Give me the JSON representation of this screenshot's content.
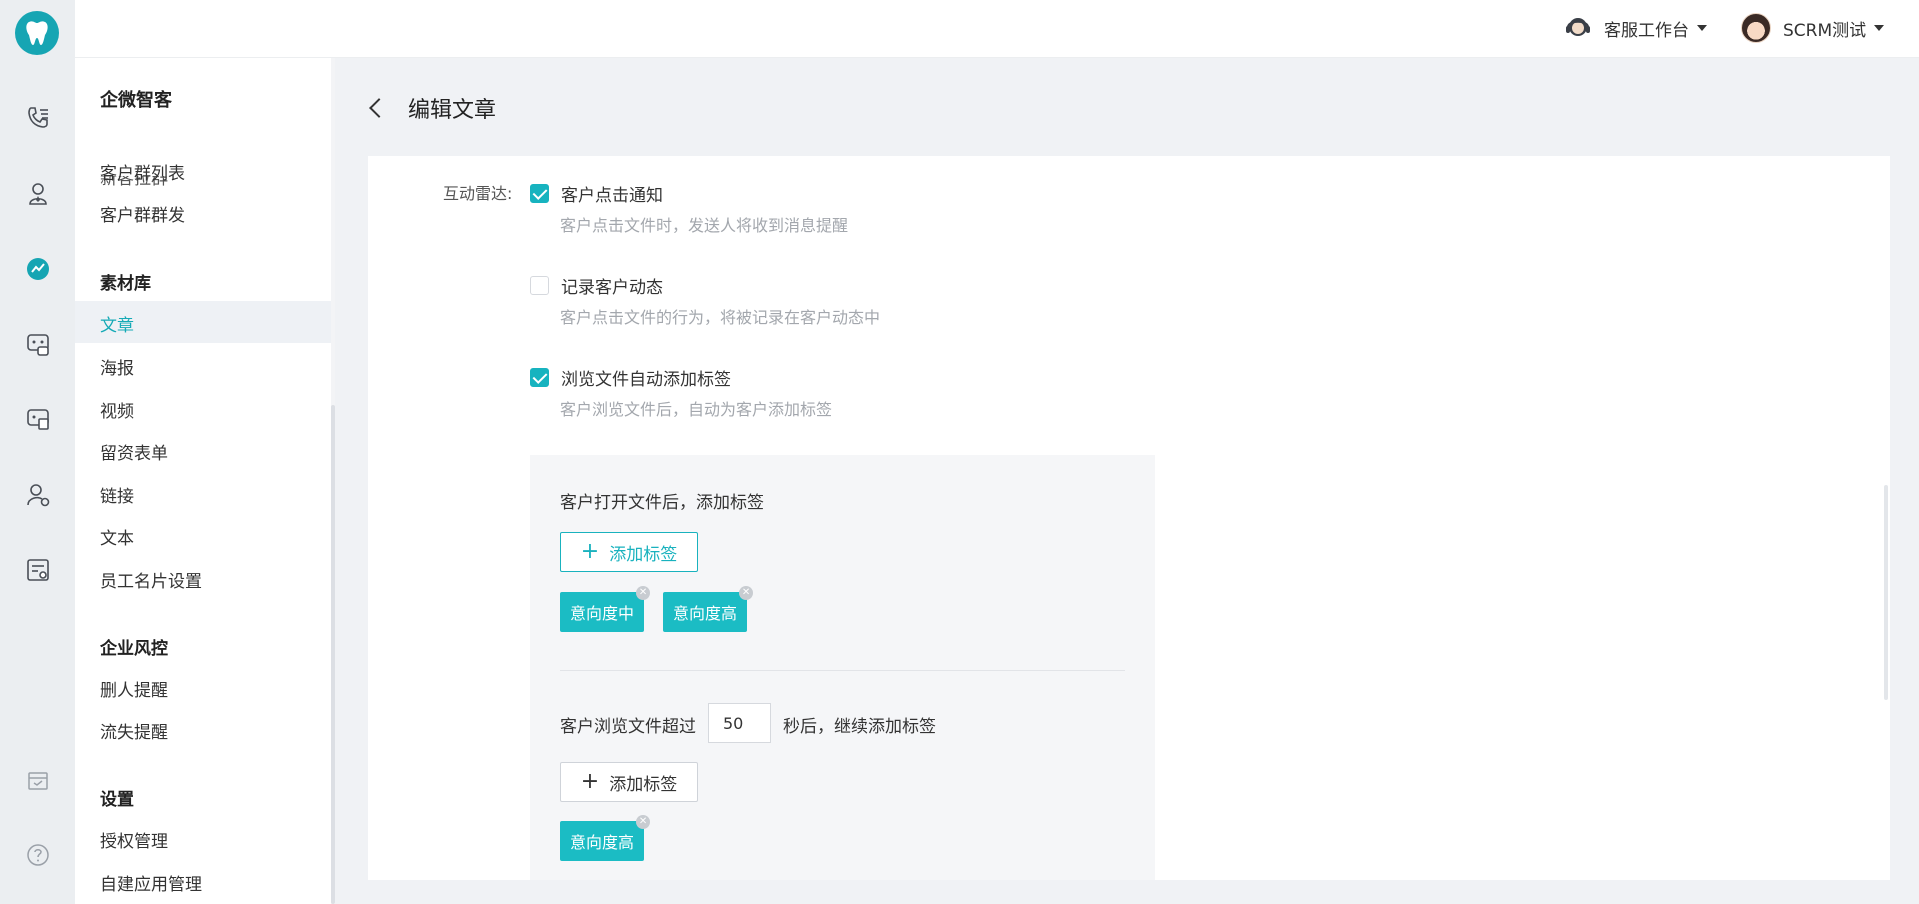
{
  "topbar": {
    "service_label": "客服工作台",
    "user_label": "SCRM测试"
  },
  "sidebar": {
    "title": "企微智客",
    "clipped_item": "新客拉群",
    "items_top": [
      "客户群列表",
      "客户群群发"
    ],
    "material_title": "素材库",
    "material_items": [
      "文章",
      "海报",
      "视频",
      "留资表单",
      "链接",
      "文本",
      "员工名片设置"
    ],
    "risk_title": "企业风控",
    "risk_items": [
      "删人提醒",
      "流失提醒"
    ],
    "settings_title": "设置",
    "settings_items": [
      "授权管理",
      "自建应用管理"
    ]
  },
  "page": {
    "title": "编辑文章"
  },
  "form": {
    "radar_label": "互动雷达:",
    "options": [
      {
        "label": "客户点击通知",
        "desc": "客户点击文件时，发送人将收到消息提醒",
        "checked": true
      },
      {
        "label": "记录客户动态",
        "desc": "客户点击文件的行为，将被记录在客户动态中",
        "checked": false
      },
      {
        "label": "浏览文件自动添加标签",
        "desc": "客户浏览文件后，自动为客户添加标签",
        "checked": true
      }
    ],
    "panel": {
      "open_text": "客户打开文件后，添加标签",
      "add_tag_label": "添加标签",
      "open_tags": [
        "意向度中",
        "意向度高"
      ],
      "browse_prefix": "客户浏览文件超过",
      "browse_seconds": "50",
      "browse_suffix": "秒后，继续添加标签",
      "browse_tags": [
        "意向度高"
      ]
    }
  },
  "colors": {
    "accent": "#17b3bf",
    "tag": "#1bbcc4",
    "logo": "#16a5b3"
  }
}
